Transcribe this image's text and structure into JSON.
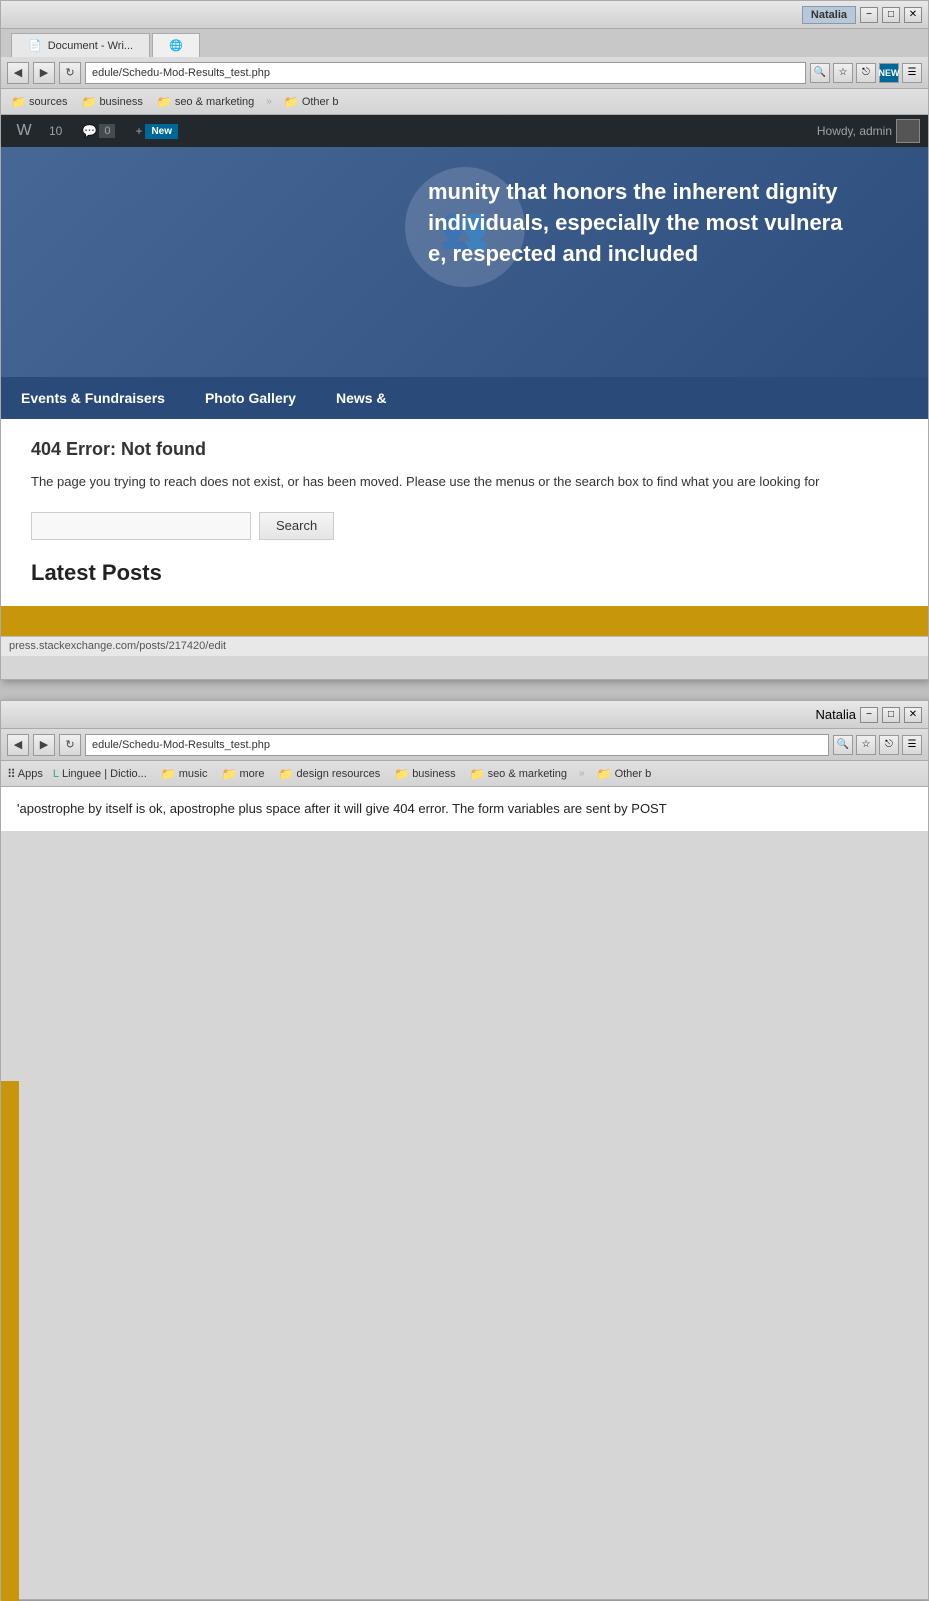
{
  "top_window": {
    "titlebar": {
      "user_label": "Natalia",
      "minimize_label": "−",
      "maximize_label": "□",
      "close_label": "✕"
    },
    "tabs": [
      {
        "id": "tab1",
        "label": "Document - Wri...",
        "active": false
      },
      {
        "id": "tab2",
        "label": "",
        "active": true
      }
    ],
    "address_bar": {
      "url": "edule/Schedu-Mod-Results_test.php",
      "search_icon": "🔍",
      "star_icon": "☆",
      "new_badge": "NEW"
    },
    "bookmarks": {
      "sources_label": "sources",
      "business_label": "business",
      "seo_label": "seo & marketing",
      "more_label": "»",
      "other_label": "Other b"
    },
    "wp_admin": {
      "logo": "W",
      "items": [
        {
          "label": "10",
          "type": "count"
        },
        {
          "label": "0",
          "type": "comment"
        },
        {
          "label": "New",
          "type": "new"
        }
      ],
      "howdy": "Howdy, admin"
    },
    "hero": {
      "text_line1": "munity that honors the inherent dignity",
      "text_line2": "individuals, especially the most vulnera",
      "text_line3": "e, respected and included"
    },
    "nav": {
      "items": [
        {
          "label": "Events & Fundraisers"
        },
        {
          "label": "Photo Gallery"
        },
        {
          "label": "News &"
        }
      ]
    },
    "error": {
      "title": "404 Error: Not found",
      "message": "The page you trying to reach does not exist, or has been moved. Please use the menus or the search box to find what you are looking for",
      "search_placeholder": "",
      "search_button_label": "Search",
      "latest_posts_label": "Latest Posts"
    },
    "status": {
      "url": "press.stackexchange.com/posts/217420/edit"
    }
  },
  "bottom_window": {
    "titlebar": {
      "user_label": "Natalia",
      "minimize_label": "−",
      "maximize_label": "□",
      "close_label": "✕"
    },
    "address_bar": {
      "url": "edule/Schedu-Mod-Results_test.php"
    },
    "bookmarks": {
      "apps_label": "Apps",
      "linguee_label": "Linguee | Dictio...",
      "music_label": "music",
      "more_label": "more",
      "design_label": "design resources",
      "business_label": "business",
      "seo_label": "seo & marketing",
      "more_btn": "»",
      "other_label": "Other b"
    },
    "page_text": "'apostrophe by itself is ok, apostrophe plus space after it will give 404 error. The form variables are sent by POST"
  }
}
